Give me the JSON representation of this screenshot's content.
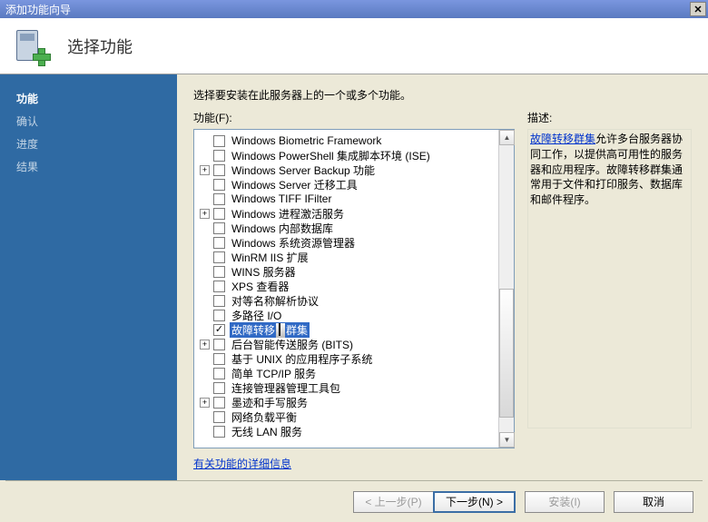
{
  "title_bar": {
    "title": "添加功能向导"
  },
  "header": {
    "title": "选择功能"
  },
  "sidebar": {
    "items": [
      {
        "label": "功能",
        "active": true
      },
      {
        "label": "确认",
        "active": false
      },
      {
        "label": "进度",
        "active": false
      },
      {
        "label": "结果",
        "active": false
      }
    ]
  },
  "main": {
    "instruction": "选择要安装在此服务器上的一个或多个功能。",
    "features_label": "功能(F):",
    "tree": [
      {
        "expandable": false,
        "checked": false,
        "label": "Windows Biometric Framework",
        "selected": false
      },
      {
        "expandable": false,
        "checked": false,
        "label": "Windows PowerShell 集成脚本环境 (ISE)",
        "selected": false
      },
      {
        "expandable": true,
        "checked": false,
        "label": "Windows Server Backup 功能",
        "selected": false
      },
      {
        "expandable": false,
        "checked": false,
        "label": "Windows Server 迁移工具",
        "selected": false
      },
      {
        "expandable": false,
        "checked": false,
        "label": "Windows TIFF IFilter",
        "selected": false
      },
      {
        "expandable": true,
        "checked": false,
        "label": "Windows 进程激活服务",
        "selected": false
      },
      {
        "expandable": false,
        "checked": false,
        "label": "Windows 内部数据库",
        "selected": false
      },
      {
        "expandable": false,
        "checked": false,
        "label": "Windows 系统资源管理器",
        "selected": false
      },
      {
        "expandable": false,
        "checked": false,
        "label": "WinRM IIS 扩展",
        "selected": false
      },
      {
        "expandable": false,
        "checked": false,
        "label": "WINS 服务器",
        "selected": false
      },
      {
        "expandable": false,
        "checked": false,
        "label": "XPS 查看器",
        "selected": false
      },
      {
        "expandable": false,
        "checked": false,
        "label": "对等名称解析协议",
        "selected": false
      },
      {
        "expandable": false,
        "checked": false,
        "label": "多路径 I/O",
        "selected": false
      },
      {
        "expandable": false,
        "checked": true,
        "label_parts": [
          "故障转移",
          "群集"
        ],
        "selected": true,
        "cursor": true
      },
      {
        "expandable": true,
        "checked": false,
        "label": "后台智能传送服务 (BITS)",
        "selected": false
      },
      {
        "expandable": false,
        "checked": false,
        "label": "基于 UNIX 的应用程序子系统",
        "selected": false
      },
      {
        "expandable": false,
        "checked": false,
        "label": "简单 TCP/IP 服务",
        "selected": false
      },
      {
        "expandable": false,
        "checked": false,
        "label": "连接管理器管理工具包",
        "selected": false
      },
      {
        "expandable": true,
        "checked": false,
        "label": "墨迹和手写服务",
        "selected": false
      },
      {
        "expandable": false,
        "checked": false,
        "label": "网络负载平衡",
        "selected": false
      },
      {
        "expandable": false,
        "checked": false,
        "label": "无线 LAN 服务",
        "selected": false
      }
    ],
    "more_link": "有关功能的详细信息",
    "scroll": {
      "thumb_top_pct": 50,
      "thumb_height_pct": 45
    }
  },
  "description": {
    "title": "描述:",
    "link_text": "故障转移群集",
    "body": "允许多台服务器协同工作，以提供高可用性的服务器和应用程序。故障转移群集通常用于文件和打印服务、数据库和邮件程序。"
  },
  "footer": {
    "prev": "< 上一步(P)",
    "next": "下一步(N) >",
    "install": "安装(I)",
    "cancel": "取消"
  }
}
